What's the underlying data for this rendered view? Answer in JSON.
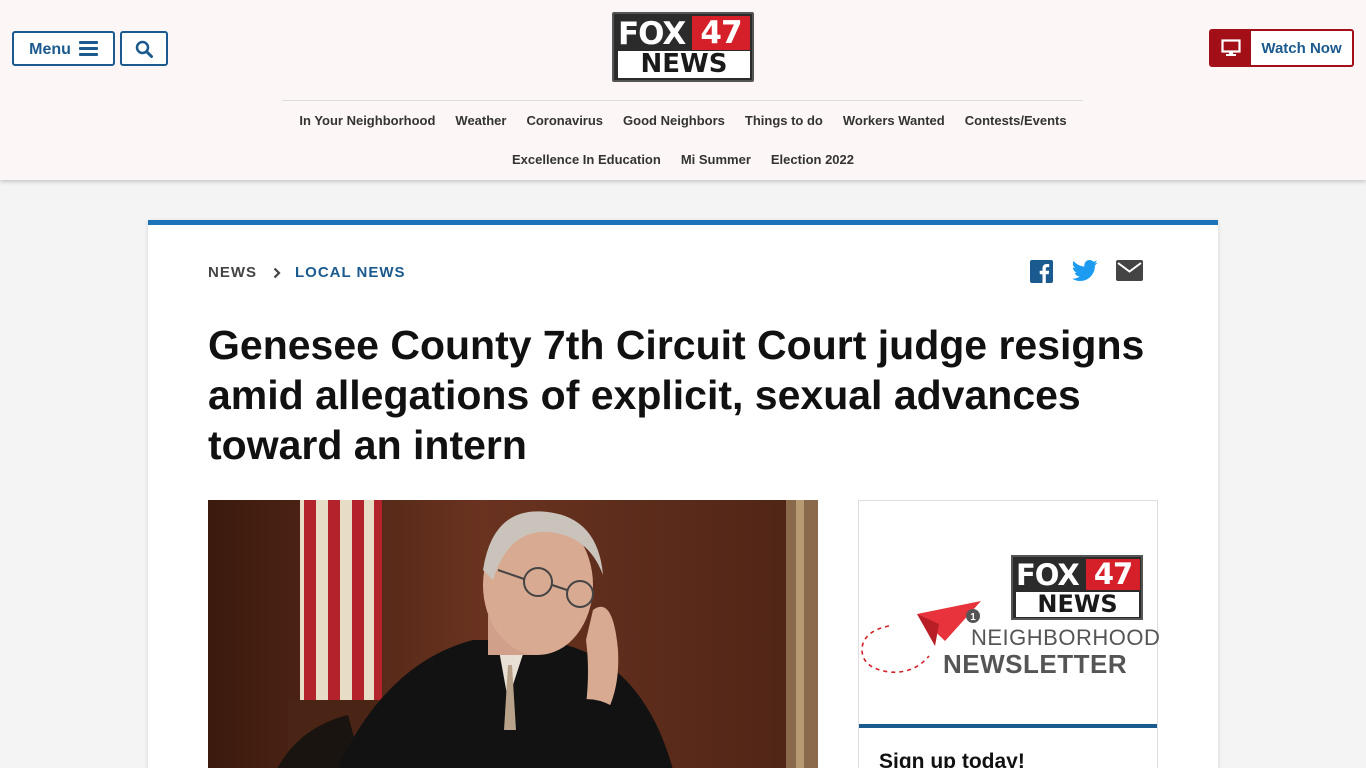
{
  "header": {
    "menu_label": "Menu",
    "search_icon": "search-icon",
    "logo": {
      "fox": "FOX",
      "number": "47",
      "news": "NEWS"
    },
    "watch_now_label": "Watch Now",
    "watch_icon": "monitor-icon",
    "nav_row1": [
      "In Your Neighborhood",
      "Weather",
      "Coronavirus",
      "Good Neighbors",
      "Things to do",
      "Workers Wanted",
      "Contests/Events"
    ],
    "nav_row2": [
      "Excellence In Education",
      "Mi Summer",
      "Election 2022"
    ]
  },
  "breadcrumb": {
    "section": "NEWS",
    "subsection": "LOCAL NEWS"
  },
  "share_icons": [
    "facebook-icon",
    "twitter-icon",
    "email-icon"
  ],
  "article": {
    "headline": "Genesee County 7th Circuit Court judge resigns amid allegations of explicit, sexual advances toward an intern"
  },
  "promo": {
    "logo": {
      "fox": "FOX",
      "number": "47",
      "news": "NEWS"
    },
    "badge": "1",
    "line1": "NEIGHBORHOOD",
    "line2": "NEWSLETTER",
    "signup": "Sign up today!"
  },
  "colors": {
    "brand_blue": "#1b5a8e",
    "accent_blue": "#1b73b8",
    "brand_red": "#d62029",
    "watch_red": "#a30f16",
    "header_bg": "#fdf6f6"
  }
}
